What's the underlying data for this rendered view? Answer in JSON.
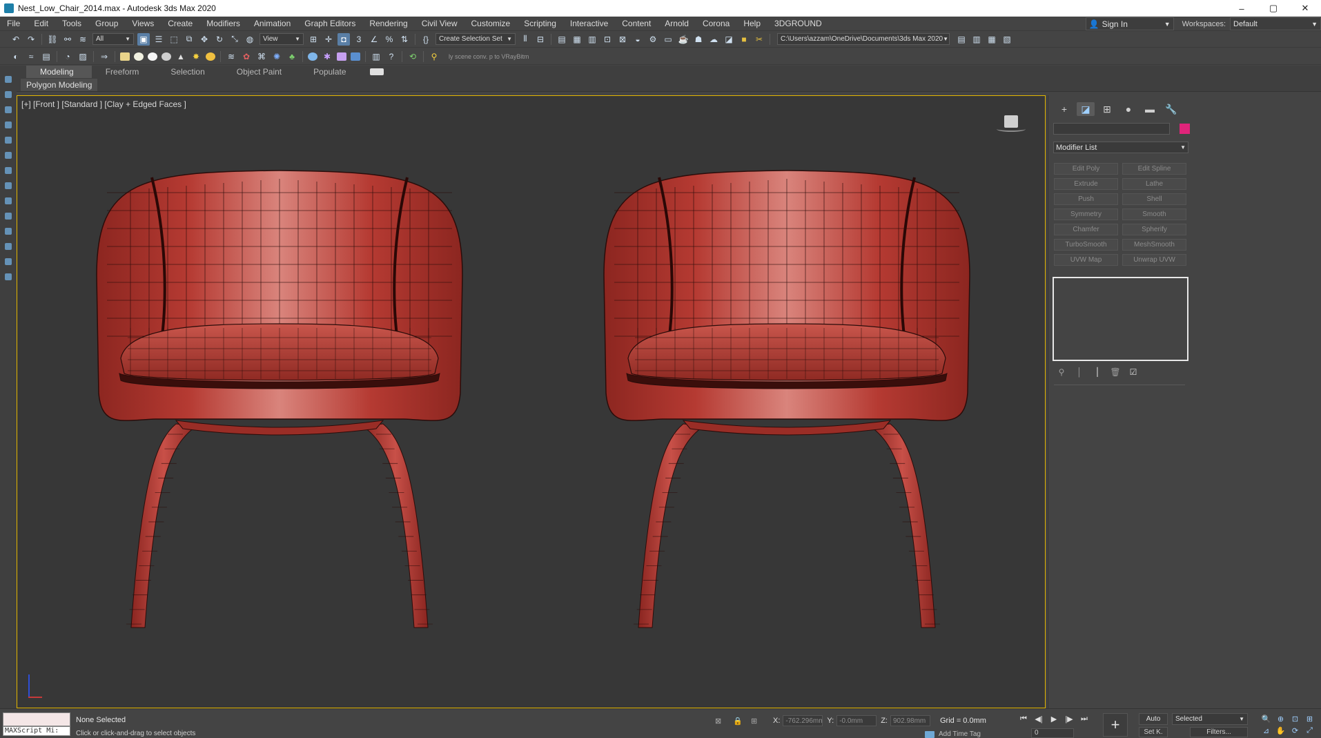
{
  "window": {
    "title": "Nest_Low_Chair_2014.max - Autodesk 3ds Max 2020",
    "minimize": "–",
    "maximize": "▢",
    "close": "✕"
  },
  "menu": {
    "items": [
      "File",
      "Edit",
      "Tools",
      "Group",
      "Views",
      "Create",
      "Modifiers",
      "Animation",
      "Graph Editors",
      "Rendering",
      "Civil View",
      "Customize",
      "Scripting",
      "Interactive",
      "Content",
      "Arnold",
      "Corona",
      "Help",
      "3DGROUND"
    ],
    "sign_in": "Sign In",
    "workspaces_label": "Workspaces:",
    "workspace_value": "Default"
  },
  "toolbar": {
    "selection_filter": "All",
    "reference_coord": "View",
    "selection_set": "Create Selection Set",
    "project_path": "C:\\Users\\azzam\\OneDrive\\Documents\\3ds Max 2020",
    "hint_text": "ly scene conv. p to VRayBitm"
  },
  "ribbon": {
    "tabs": [
      "Modeling",
      "Freeform",
      "Selection",
      "Object Paint",
      "Populate"
    ],
    "active_tab": "Modeling",
    "sub_panel": "Polygon Modeling"
  },
  "viewport": {
    "label": "[+] [Front ] [Standard ] [Clay + Edged Faces ]",
    "chair_color": "#b53a32",
    "wire_color": "#2a0c0a",
    "highlight_color": "#d9847c",
    "border_color": "#e4b800"
  },
  "command_panel": {
    "object_color": "#e0247a",
    "modifier_list": "Modifier List",
    "modifier_buttons": [
      "Edit Poly",
      "Edit Spline",
      "Extrude",
      "Lathe",
      "Push",
      "Shell",
      "Symmetry",
      "Smooth",
      "Chamfer",
      "Spherify",
      "TurboSmooth",
      "MeshSmooth",
      "UVW Map",
      "Unwrap UVW"
    ]
  },
  "status": {
    "maxscript_label": "MAXScript Mi:",
    "selection": "None Selected",
    "prompt": "Click or click-and-drag to select objects",
    "x_label": "X:",
    "x_value": "-762.296mm",
    "y_label": "Y:",
    "y_value": "-0.0mm",
    "z_label": "Z:",
    "z_value": "902.98mm",
    "grid": "Grid = 0.0mm",
    "add_time_tag": "Add Time Tag",
    "frame": "0",
    "auto_key": "Auto",
    "set_key": "Set K.",
    "key_mode": "Selected",
    "filters": "Filters..."
  }
}
